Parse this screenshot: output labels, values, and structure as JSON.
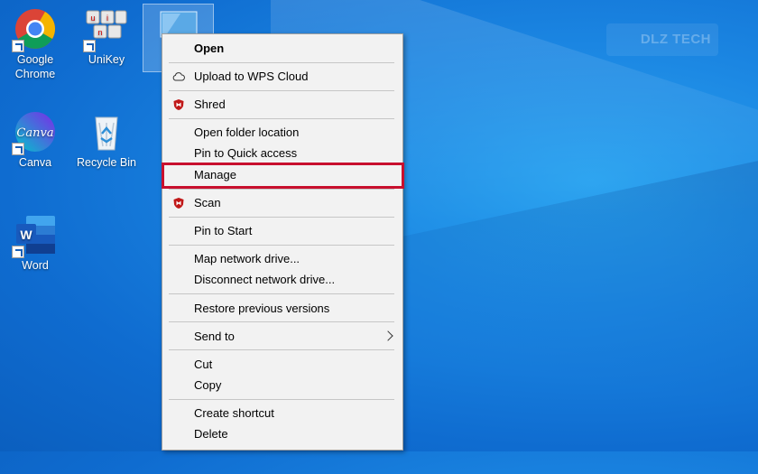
{
  "desktop": {
    "icons": [
      {
        "label": "Google\nChrome",
        "icon": "chrome-icon"
      },
      {
        "label": "UniKey",
        "icon": "unikey-icon"
      },
      {
        "label": "Canva",
        "icon": "canva-icon"
      },
      {
        "label": "Recycle Bin",
        "icon": "recycle-bin-icon"
      },
      {
        "label": "Word",
        "icon": "word-icon"
      }
    ],
    "watermark": "DLZ TECH"
  },
  "context_menu": {
    "items": [
      {
        "label": "Open",
        "bold": true
      },
      {
        "label": "Upload to WPS Cloud",
        "icon": "cloud-icon"
      },
      {
        "label": "Shred",
        "icon": "mcafee-icon"
      },
      {
        "label": "Open folder location"
      },
      {
        "label": "Pin to Quick access"
      },
      {
        "label": "Manage",
        "highlighted": true
      },
      {
        "label": "Scan",
        "icon": "mcafee-icon"
      },
      {
        "label": "Pin to Start"
      },
      {
        "label": "Map network drive..."
      },
      {
        "label": "Disconnect network drive..."
      },
      {
        "label": "Restore previous versions"
      },
      {
        "label": "Send to",
        "submenu": true
      },
      {
        "label": "Cut"
      },
      {
        "label": "Copy"
      },
      {
        "label": "Create shortcut"
      },
      {
        "label": "Delete"
      }
    ],
    "highlight_color": "#c8102e",
    "menu_bg": "#f2f2f2"
  }
}
